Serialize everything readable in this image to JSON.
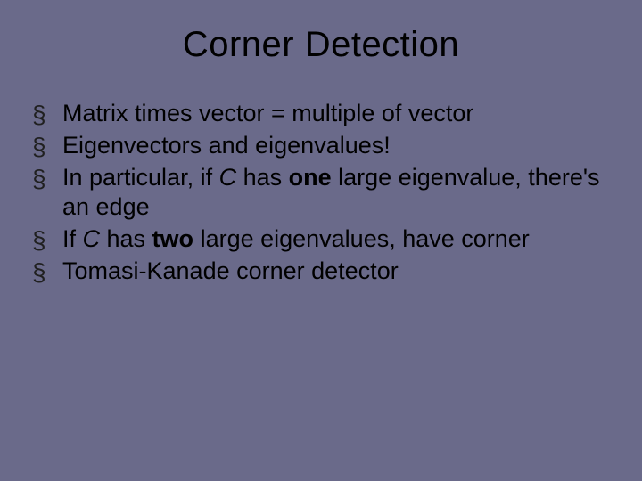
{
  "title": "Corner Detection",
  "bullets": {
    "0": {
      "text": "Matrix times vector = multiple of vector"
    },
    "1": {
      "text": "Eigenvectors and eigenvalues!"
    },
    "2": {
      "pre": "In particular, if ",
      "c": "C",
      "mid": " has ",
      "one": "one",
      "rest": " large eigenvalue, there's an edge"
    },
    "3": {
      "pre": "If ",
      "c": "C",
      "mid": " has ",
      "two": "two",
      "rest": " large eigenvalues, have corner"
    },
    "4": {
      "text": "Tomasi-Kanade corner detector"
    }
  }
}
